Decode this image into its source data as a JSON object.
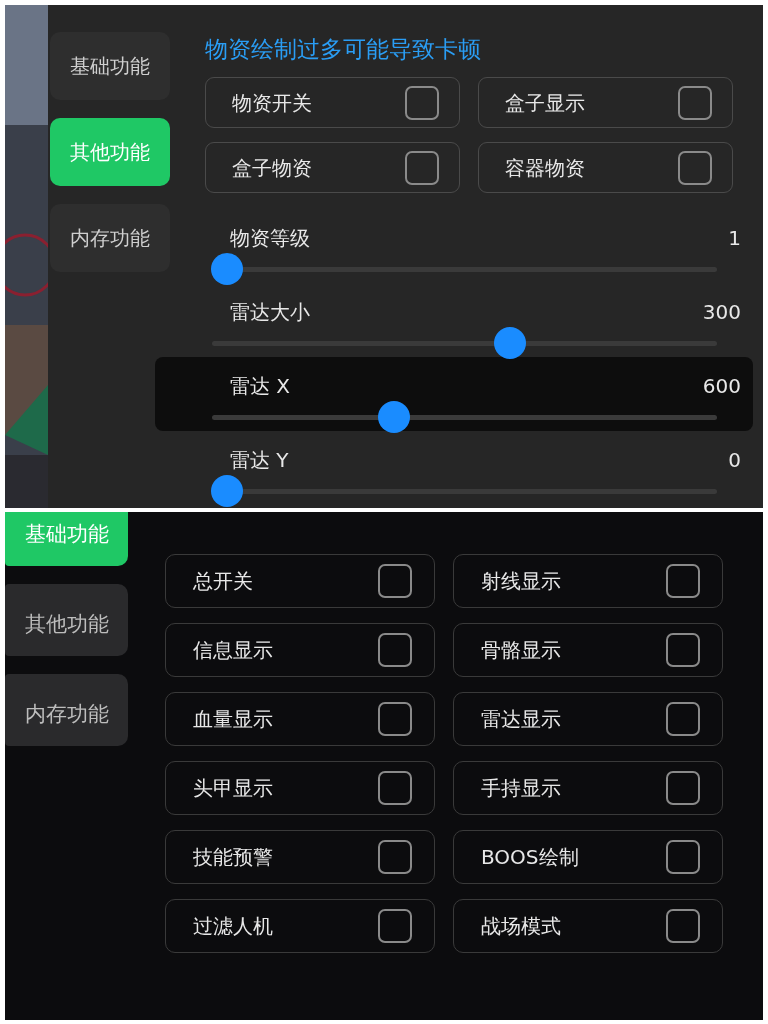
{
  "panels": [
    {
      "kind": "items",
      "tabs": [
        {
          "label": "基础功能",
          "selected": false
        },
        {
          "label": "其他功能",
          "selected": true
        },
        {
          "label": "内存功能",
          "selected": false
        }
      ],
      "notice": "物资绘制过多可能导致卡顿",
      "toggles": [
        {
          "label": "物资开关",
          "checked": false
        },
        {
          "label": "盒子显示",
          "checked": false
        },
        {
          "label": "盒子物资",
          "checked": false
        },
        {
          "label": "容器物资",
          "checked": false
        }
      ],
      "sliders": [
        {
          "label": "物资等级",
          "reading": "1",
          "level": 0.03,
          "selected": false
        },
        {
          "label": "雷达大小",
          "reading": "300",
          "level": 0.59,
          "selected": false
        },
        {
          "label": "雷达 X",
          "reading": "600",
          "level": 0.36,
          "selected": true
        },
        {
          "label": "雷达 Y",
          "reading": "0",
          "level": 0.03,
          "selected": false
        }
      ]
    },
    {
      "kind": "basic",
      "tabs": [
        {
          "label": "基础功能",
          "selected": true
        },
        {
          "label": "其他功能",
          "selected": false
        },
        {
          "label": "内存功能",
          "selected": false
        }
      ],
      "toggles": [
        {
          "label": "总开关",
          "checked": false
        },
        {
          "label": "射线显示",
          "checked": false
        },
        {
          "label": "信息显示",
          "checked": false
        },
        {
          "label": "骨骼显示",
          "checked": false
        },
        {
          "label": "血量显示",
          "checked": false
        },
        {
          "label": "雷达显示",
          "checked": false
        },
        {
          "label": "头甲显示",
          "checked": false
        },
        {
          "label": "手持显示",
          "checked": false
        },
        {
          "label": "技能预警",
          "checked": false
        },
        {
          "label": "BOOS绘制",
          "checked": false
        },
        {
          "label": "过滤人机",
          "checked": false
        },
        {
          "label": "战场模式",
          "checked": false
        }
      ]
    }
  ]
}
